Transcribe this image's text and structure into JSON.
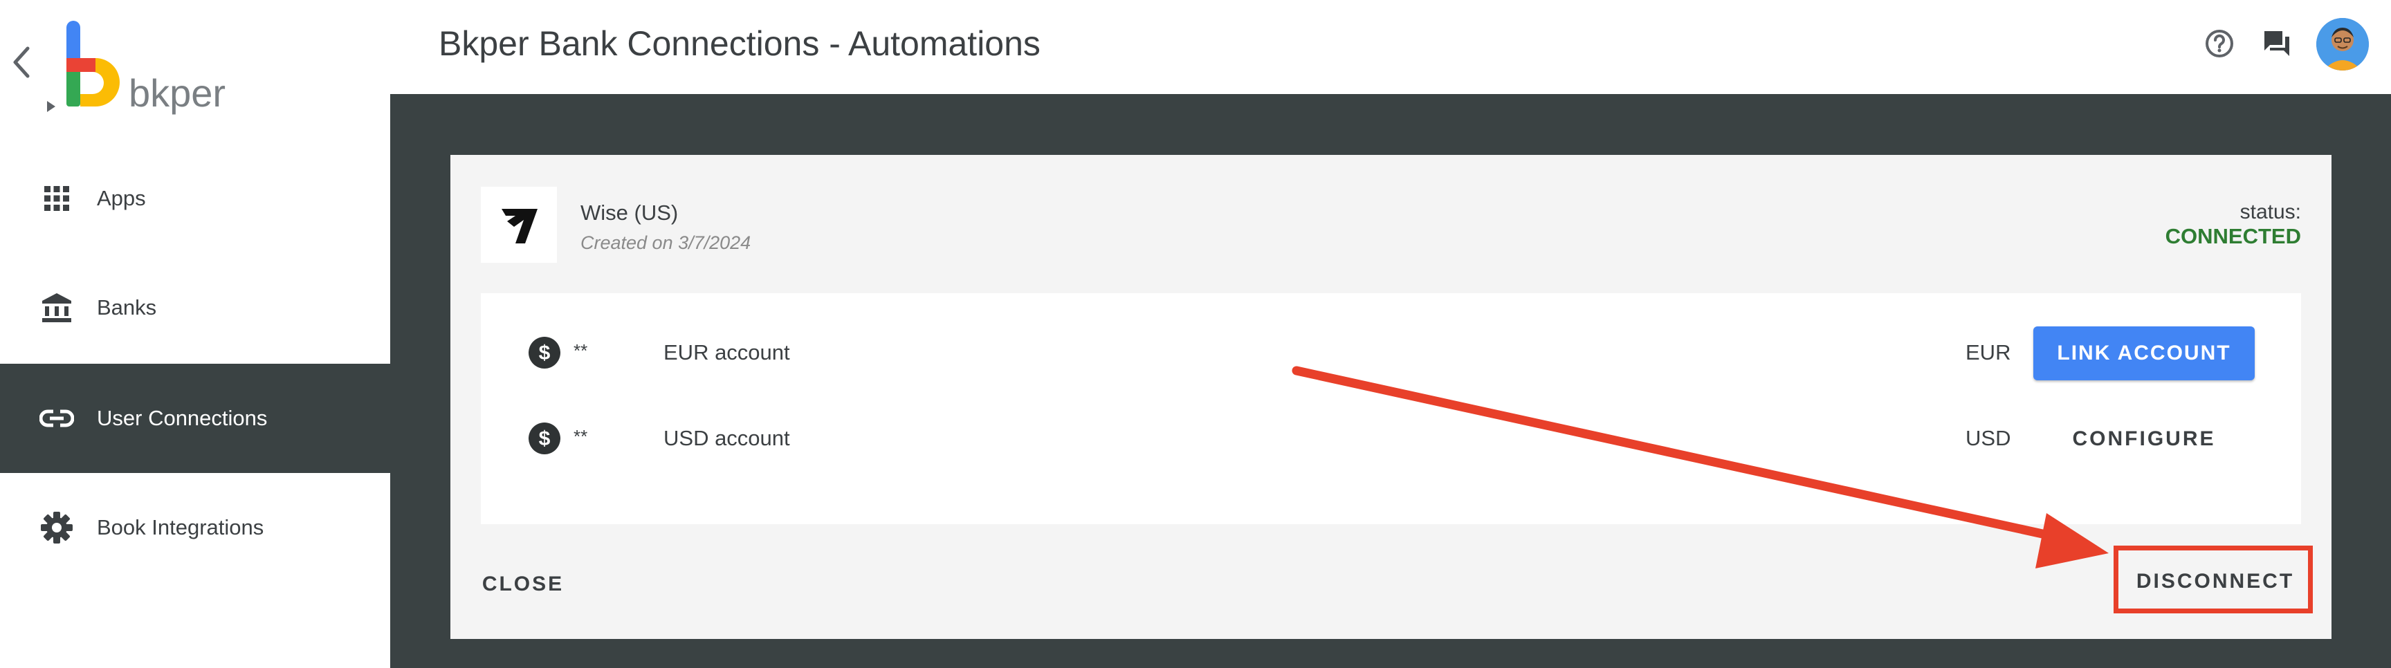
{
  "app": {
    "logo_text": "bkper",
    "page_title": "Bkper Bank Connections - Automations"
  },
  "sidebar": {
    "items": [
      {
        "label": "Apps",
        "icon": "apps-grid-icon",
        "active": false
      },
      {
        "label": "Banks",
        "icon": "bank-icon",
        "active": false
      },
      {
        "label": "User Connections",
        "icon": "link-icon",
        "active": true
      },
      {
        "label": "Book Integrations",
        "icon": "gear-icon",
        "active": false
      }
    ]
  },
  "header_icons": [
    "help-icon",
    "feedback-icon",
    "avatar"
  ],
  "connection": {
    "name": "Wise (US)",
    "created": "Created on 3/7/2024",
    "status_label": "status:",
    "status_value": "CONNECTED",
    "accounts": [
      {
        "number": "**",
        "name": "EUR account",
        "currency": "EUR",
        "action": "LINK ACCOUNT"
      },
      {
        "number": "** ",
        "name": "USD account",
        "currency": "USD",
        "action": "CONFIGURE"
      }
    ],
    "close_label": "CLOSE",
    "disconnect_label": "DISCONNECT"
  },
  "colors": {
    "dark_bg": "#3a4243",
    "accent_blue": "#4285f4",
    "status_green": "#2e7d32",
    "annotation_red": "#e8402a"
  }
}
